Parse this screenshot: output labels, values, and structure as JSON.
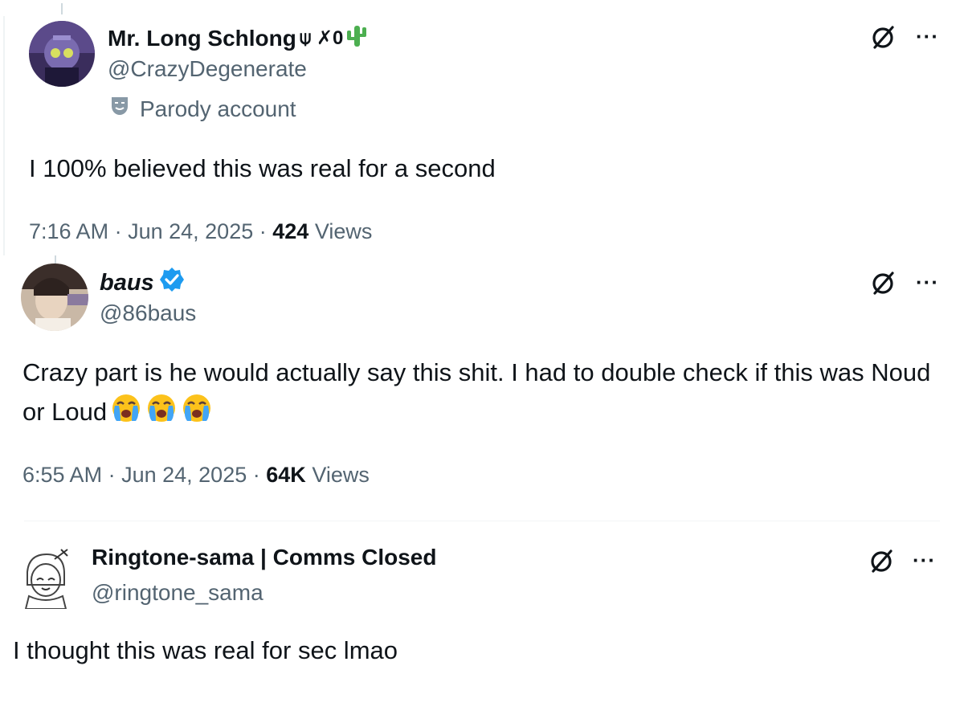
{
  "tweets": [
    {
      "display_name": "Mr. Long Schlong",
      "name_extra": "⍦ ✗0",
      "handle": "@CrazyDegenerate",
      "parody_label": "Parody account",
      "text": "I 100% believed this was real for a second",
      "time": "7:16 AM",
      "date": "Jun 24, 2025",
      "views_count": "424",
      "views_label": "Views"
    },
    {
      "display_name": "baus",
      "verified": true,
      "handle": "@86baus",
      "text": "Crazy part is he would actually say this shit. I had to double check if this was Noud or Loud",
      "time": "6:55 AM",
      "date": "Jun 24, 2025",
      "views_count": "64K",
      "views_label": "Views"
    },
    {
      "display_name": "Ringtone-sama | Comms Closed",
      "handle": "@ringtone_sama",
      "text": "I thought this was real for sec lmao"
    }
  ],
  "separator": "·",
  "more_label": "···",
  "colors": {
    "text_primary": "#0f1419",
    "text_secondary": "#536471",
    "verified_blue": "#1d9bf0",
    "cactus_green": "#4caf50"
  },
  "icons": {
    "grok": "grok-icon",
    "more": "more-options-icon",
    "parody": "parody-mask-icon",
    "verified": "verified-badge-icon",
    "cactus": "cactus-emoji",
    "crying": "loudly-crying-face-emoji"
  }
}
